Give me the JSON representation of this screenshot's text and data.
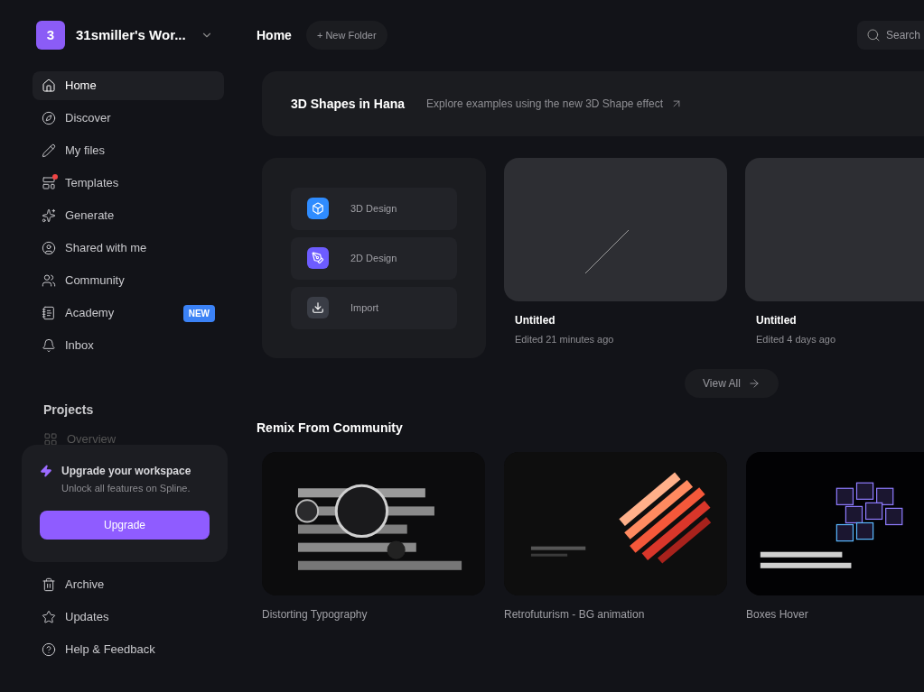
{
  "workspace": {
    "avatar": "3",
    "name": "31smiller's Wor..."
  },
  "nav": [
    {
      "label": "Home",
      "selected": true,
      "notification": false
    },
    {
      "label": "Discover",
      "selected": false,
      "notification": false
    },
    {
      "label": "My files",
      "selected": false,
      "notification": false
    },
    {
      "label": "Templates",
      "selected": false,
      "notification": true
    },
    {
      "label": "Generate",
      "selected": false,
      "notification": false
    },
    {
      "label": "Shared with me",
      "selected": false,
      "notification": false
    },
    {
      "label": "Community",
      "selected": false,
      "notification": false
    },
    {
      "label": "Academy",
      "selected": false,
      "notification": false,
      "badge": "NEW"
    },
    {
      "label": "Inbox",
      "selected": false,
      "notification": false
    }
  ],
  "projects": {
    "title": "Projects",
    "items": [
      "Overview"
    ]
  },
  "upgrade": {
    "title": "Upgrade your workspace",
    "subtitle": "Unlock all features on Spline.",
    "button": "Upgrade"
  },
  "footer_nav": [
    "Archive",
    "Updates",
    "Help & Feedback"
  ],
  "header": {
    "title": "Home",
    "new_folder": "+ New Folder",
    "search": {
      "placeholder": "Search"
    }
  },
  "banner": {
    "title": "3D Shapes in Hana",
    "text": "Explore examples using the new 3D Shape effect"
  },
  "create": [
    {
      "label": "3D Design",
      "color": "#2f8cff"
    },
    {
      "label": "2D Design",
      "color": "#6d5cff"
    },
    {
      "label": "Import",
      "color": "#3a3d46"
    }
  ],
  "files": [
    {
      "title": "Untitled",
      "subtitle": "Edited 21 minutes ago"
    },
    {
      "title": "Untitled",
      "subtitle": "Edited 4 days ago"
    }
  ],
  "view_all": "View All",
  "remix": {
    "title": "Remix From Community",
    "items": [
      "Distorting Typography",
      "Retrofuturism - BG animation",
      "Boxes Hover"
    ]
  }
}
